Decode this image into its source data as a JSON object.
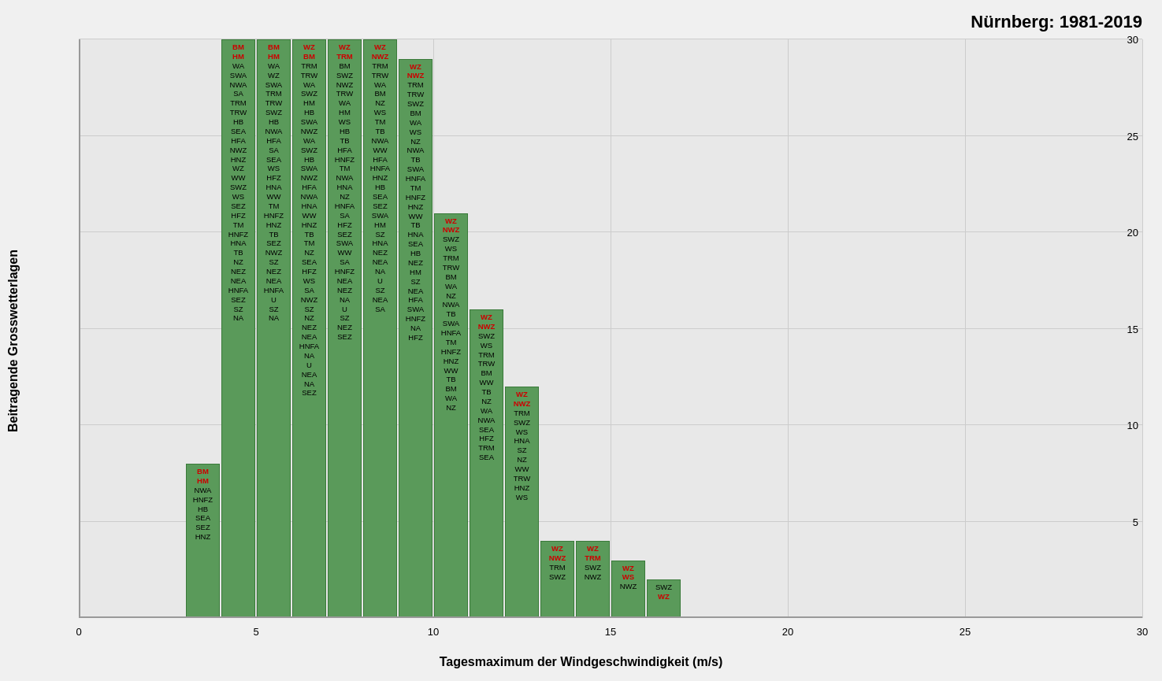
{
  "title": "Nürnberg: 1981-2019",
  "y_axis_label": "Beitragende Grosswetterlagen",
  "x_axis_label": "Tagesmaximum der Windgeschwindigkeit (m/s)",
  "y_ticks": [
    0,
    5,
    10,
    15,
    20,
    25,
    30
  ],
  "x_ticks": [
    0,
    5,
    10,
    15,
    20,
    25,
    30
  ],
  "y_max": 30,
  "x_min": 0,
  "x_max": 30,
  "bars": [
    {
      "x_start": 3,
      "x_end": 4,
      "height": 8,
      "labels": [
        "BM",
        "HM",
        "NWA",
        "HNFZ",
        "HB",
        "SEA",
        "SEZ",
        "HNZ"
      ],
      "red_labels": [
        "BM",
        "HM"
      ]
    },
    {
      "x_start": 4,
      "x_end": 5,
      "height": 30,
      "labels": [
        "BM",
        "HM",
        "WA",
        "SWA",
        "NWA",
        "SA",
        "TRM",
        "TRW",
        "HB",
        "SEA",
        "HFA",
        "NWZ",
        "HNZ",
        "WZ",
        "WW",
        "SWZ",
        "WS",
        "SEZ",
        "HFZ",
        "TM",
        "HNFZ",
        "HNA",
        "TB",
        "NZ",
        "NEZ",
        "NEA",
        "HNFA",
        "SEZ",
        "SZ",
        "NA"
      ],
      "red_labels": [
        "BM",
        "HM"
      ]
    },
    {
      "x_start": 5,
      "x_end": 6,
      "height": 30,
      "labels": [
        "BM",
        "HM",
        "WA",
        "WZ",
        "SWA",
        "TRM",
        "TRW",
        "SWZ",
        "HB",
        "NWA",
        "HFA",
        "SA",
        "SEA",
        "WS",
        "HFZ",
        "HNA",
        "WW",
        "TM",
        "HNFZ",
        "HNZ",
        "TB",
        "SEZ",
        "NWZ",
        "SZ",
        "NEZ",
        "NEA",
        "HNFA",
        "U",
        "SZ",
        "NA"
      ],
      "red_labels": [
        "BM",
        "HM"
      ]
    },
    {
      "x_start": 6,
      "x_end": 7,
      "height": 30,
      "labels": [
        "WZ",
        "BM",
        "TRM",
        "TRW",
        "WA",
        "SWZ",
        "HM",
        "HB",
        "SWA",
        "NWZ",
        "WA",
        "SWZ",
        "HB",
        "SWA",
        "NWZ",
        "HFA",
        "NWA",
        "HNA",
        "WW",
        "HNZ",
        "TB",
        "TM",
        "NZ",
        "SEA",
        "HFZ",
        "WS",
        "SA",
        "NWZ",
        "SZ",
        "NZ",
        "NEZ",
        "NEA",
        "HNFA",
        "NA",
        "U",
        "NEA",
        "NA",
        "SEZ"
      ],
      "red_labels": [
        "WZ",
        "BM"
      ]
    },
    {
      "x_start": 7,
      "x_end": 8,
      "height": 30,
      "labels": [
        "WZ",
        "TRM",
        "BM",
        "SWZ",
        "NWZ",
        "TRW",
        "WA",
        "HM",
        "WS",
        "HB",
        "TB",
        "HFA",
        "HNFZ",
        "TM",
        "NWA",
        "HNA",
        "NZ",
        "HNFA",
        "SA",
        "HFZ",
        "SEZ",
        "SWA",
        "WW",
        "SA",
        "HNFZ",
        "NEA",
        "NEZ",
        "NA",
        "U",
        "SZ",
        "NEZ",
        "SEZ"
      ],
      "red_labels": [
        "WZ",
        "TRM"
      ]
    },
    {
      "x_start": 8,
      "x_end": 9,
      "height": 30,
      "labels": [
        "WZ",
        "NWZ",
        "TRM",
        "TRW",
        "WA",
        "BM",
        "NZ",
        "WS",
        "TM",
        "TB",
        "NWA",
        "WW",
        "HFA",
        "HNFA",
        "HNZ",
        "HB",
        "SEA",
        "SEZ",
        "SWA",
        "HM",
        "SZ",
        "HNA",
        "NEZ",
        "NEA",
        "NA",
        "U",
        "SZ",
        "NEA",
        "SA"
      ],
      "red_labels": [
        "WZ",
        "NWZ"
      ]
    },
    {
      "x_start": 9,
      "x_end": 10,
      "height": 29,
      "labels": [
        "WZ",
        "NWZ",
        "TRM",
        "TRW",
        "SWZ",
        "BM",
        "WA",
        "WS",
        "NZ",
        "NWA",
        "TB",
        "SWA",
        "HNFA",
        "TM",
        "HNFZ",
        "HNZ",
        "WW",
        "TB",
        "HNA",
        "SEA",
        "HB",
        "NEZ",
        "HM",
        "SZ",
        "NEA",
        "HFA",
        "SWA",
        "HNFZ",
        "NA",
        "HFZ"
      ],
      "red_labels": [
        "WZ",
        "NWZ"
      ]
    },
    {
      "x_start": 10,
      "x_end": 11,
      "height": 21,
      "labels": [
        "WZ",
        "NWZ",
        "SWZ",
        "WS",
        "TRM",
        "TRW",
        "BM",
        "WA",
        "NZ",
        "NWA",
        "TB",
        "SWA",
        "HNFA",
        "TM",
        "HNFZ",
        "HNZ",
        "WW",
        "TB",
        "BM",
        "WA",
        "NZ"
      ],
      "red_labels": [
        "WZ",
        "NWZ"
      ]
    },
    {
      "x_start": 11,
      "x_end": 12,
      "height": 16,
      "labels": [
        "WZ",
        "NWZ",
        "SWZ",
        "WS",
        "TRM",
        "TRW",
        "BM",
        "WW",
        "TB",
        "NZ",
        "WA",
        "NWA",
        "SEA",
        "HFZ",
        "TRM",
        "SEA"
      ],
      "red_labels": [
        "WZ",
        "NWZ"
      ]
    },
    {
      "x_start": 12,
      "x_end": 13,
      "height": 12,
      "labels": [
        "WZ",
        "NWZ",
        "TRM",
        "SWZ",
        "WS",
        "HNA",
        "SZ",
        "NZ",
        "WW",
        "TRW",
        "HNZ",
        "WS"
      ],
      "red_labels": [
        "WZ",
        "NWZ"
      ]
    },
    {
      "x_start": 13,
      "x_end": 14,
      "height": 4,
      "labels": [
        "WZ",
        "NWZ",
        "TRM",
        "SWZ"
      ],
      "red_labels": [
        "WZ",
        "NWZ"
      ]
    },
    {
      "x_start": 14,
      "x_end": 15,
      "height": 4,
      "labels": [
        "WZ",
        "TRM",
        "SWZ",
        "NWZ"
      ],
      "red_labels": [
        "WZ",
        "TRM"
      ]
    },
    {
      "x_start": 15,
      "x_end": 16,
      "height": 3,
      "labels": [
        "WZ",
        "WS",
        "NWZ"
      ],
      "red_labels": [
        "WZ",
        "WS"
      ]
    },
    {
      "x_start": 16,
      "x_end": 17,
      "height": 2,
      "labels": [
        "SWZ",
        "WZ"
      ],
      "red_labels": [
        "WZ"
      ]
    }
  ]
}
